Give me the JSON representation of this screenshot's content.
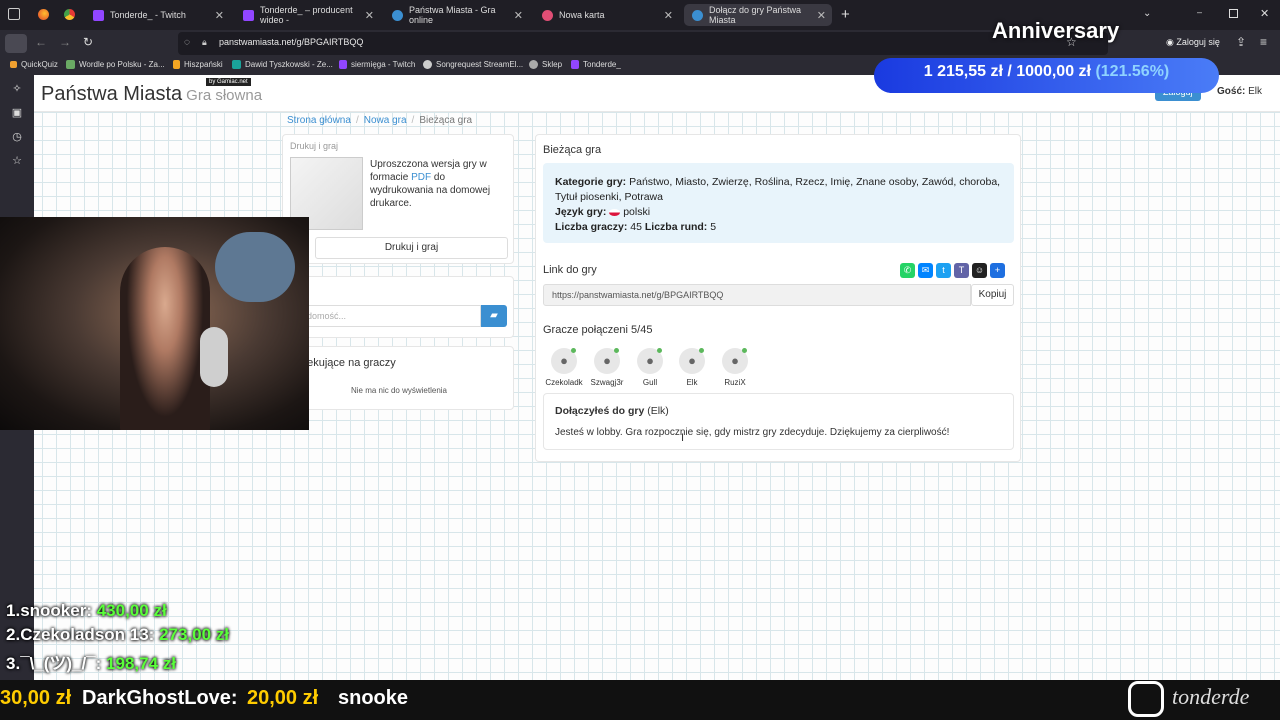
{
  "tabs": [
    {
      "label": "Tonderde_ - Twitch",
      "color": "#9146ff"
    },
    {
      "label": "Tonderde_ – producent wideo -",
      "color": "#9146ff"
    },
    {
      "label": "Państwa Miasta - Gra online",
      "color": "#3b8fd1"
    },
    {
      "label": "Nowa karta",
      "color": "#e04e75"
    },
    {
      "label": "Dołącz do gry Państwa Miasta",
      "color": "#3b8fd1"
    }
  ],
  "browser": {
    "url": "panstwamiasta.net/g/BPGAIRTBQQ",
    "login": "Zaloguj się",
    "newtab": "+"
  },
  "bookmarks": [
    "QuickQuiz",
    "Wordle po Polsku - Za...",
    "Hiszpański",
    "Dawid Tyszkowski - Ze...",
    "siermięga - Twitch",
    "Songrequest StreamEl...",
    "Sklep",
    "Tonderde_"
  ],
  "site": {
    "brand": "Państwa Miasta",
    "brand_sub": "Gra słowna",
    "badge": "by Gamiac.net",
    "login_btn": "Zaloguj",
    "guest_label": "Gość:",
    "guest_name": "Elk"
  },
  "breadcrumb": {
    "home": "Strona główna",
    "new": "Nowa gra",
    "current": "Bieżąca gra"
  },
  "print": {
    "title": "Drukuj i graj",
    "desc": "Uproszczona wersja gry w formacie",
    "pdf": "PDF",
    "desc2": "do wydrukowania na domowej drukarce.",
    "button": "Drukuj i graj"
  },
  "chat": {
    "placeholder": "adomość..."
  },
  "waiting": {
    "title": "oczekujące na graczy",
    "empty": "Nie ma nic do wyświetlenia"
  },
  "game": {
    "title": "Bieżąca gra",
    "cat_label": "Kategorie gry:",
    "categories": "Państwo, Miasto, Zwierzę, Roślina, Rzecz, Imię, Znane osoby, Zawód, choroba, Tytuł piosenki, Potrawa",
    "lang_label": "Język gry:",
    "lang": "polski",
    "players_label": "Liczba graczy:",
    "players": "45",
    "rounds_label": "Liczba rund:",
    "rounds": "5"
  },
  "link": {
    "title": "Link do gry",
    "url": "https://panstwamiasta.net/g/BPGAIRTBQQ",
    "copy": "Kopiuj"
  },
  "share_colors": [
    "#25d366",
    "#0084ff",
    "#1da1f2",
    "#6264a7",
    "#222222",
    "#1e6fe0"
  ],
  "connected": {
    "title": "Gracze połączeni 5/45",
    "players": [
      "Czekoladk",
      "Szwagj3r",
      "Gull",
      "Elk",
      "RuziX"
    ]
  },
  "joined": {
    "title": "Dołączyłeś do gry",
    "name": "(Elk)",
    "message": "Jesteś w lobby. Gra rozpocznie się, gdy mistrz gry zdecyduje. Dziękujemy za cierpliwość!"
  },
  "stream": {
    "anniversary": "Anniversary",
    "goal_current": "1 215,55 zł",
    "goal_sep": "/",
    "goal_target": "1000,00 zł",
    "goal_pct": "(121.56%)",
    "leaderboard": [
      {
        "rank": "1.",
        "name": "snooker:",
        "amount": "430,00 zł"
      },
      {
        "rank": "2.",
        "name": "Czekoladson 13:",
        "amount": "273,00 zł"
      },
      {
        "rank": "3.",
        "name": "¯\\_(ツ)_/¯:",
        "amount": "198,74 zł"
      }
    ],
    "ticker_prev": "30,00 zł",
    "ticker_name": "DarkGhostLove:",
    "ticker_amount": "20,00 zł",
    "ticker_next": "snooke",
    "instagram": "tonderde"
  }
}
